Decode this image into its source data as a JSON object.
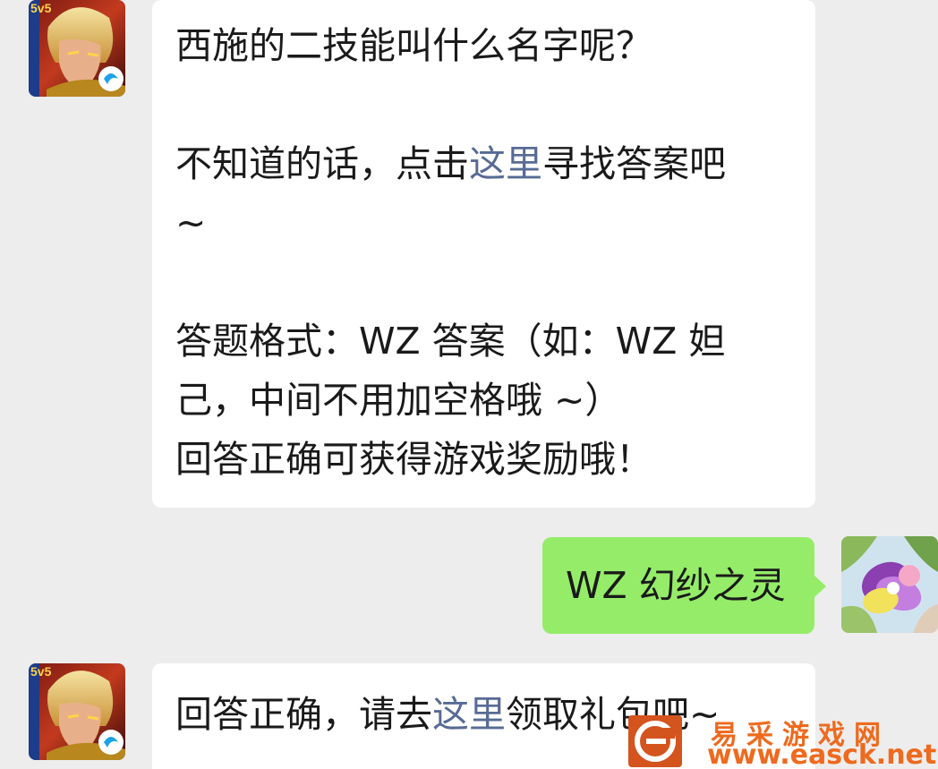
{
  "messages": [
    {
      "sender": "bot",
      "avatar_badge": "5v5",
      "lines": {
        "l1": "西施的二技能叫什么名字呢？",
        "l2_pre": "不知道的话，点击",
        "l2_link": "这里",
        "l2_post": "寻找答案吧",
        "l3": "~",
        "l4": "答题格式：WZ 答案（如：WZ 妲",
        "l5": "己，中间不用加空格哦 ~）",
        "l6": "回答正确可获得游戏奖励哦！"
      }
    },
    {
      "sender": "user",
      "text": "WZ 幻纱之灵"
    },
    {
      "sender": "bot",
      "avatar_badge": "5v5",
      "lines": {
        "pre": "回答正确，请去",
        "link": "这里",
        "post": "领取礼包吧~"
      }
    }
  ],
  "watermark": {
    "name": "易采游戏网",
    "url": "www.easck.net"
  },
  "colors": {
    "background": "#ededed",
    "incoming_bubble": "#ffffff",
    "outgoing_bubble": "#95ec69",
    "link": "#576b95",
    "watermark": "#ee6a1e"
  }
}
